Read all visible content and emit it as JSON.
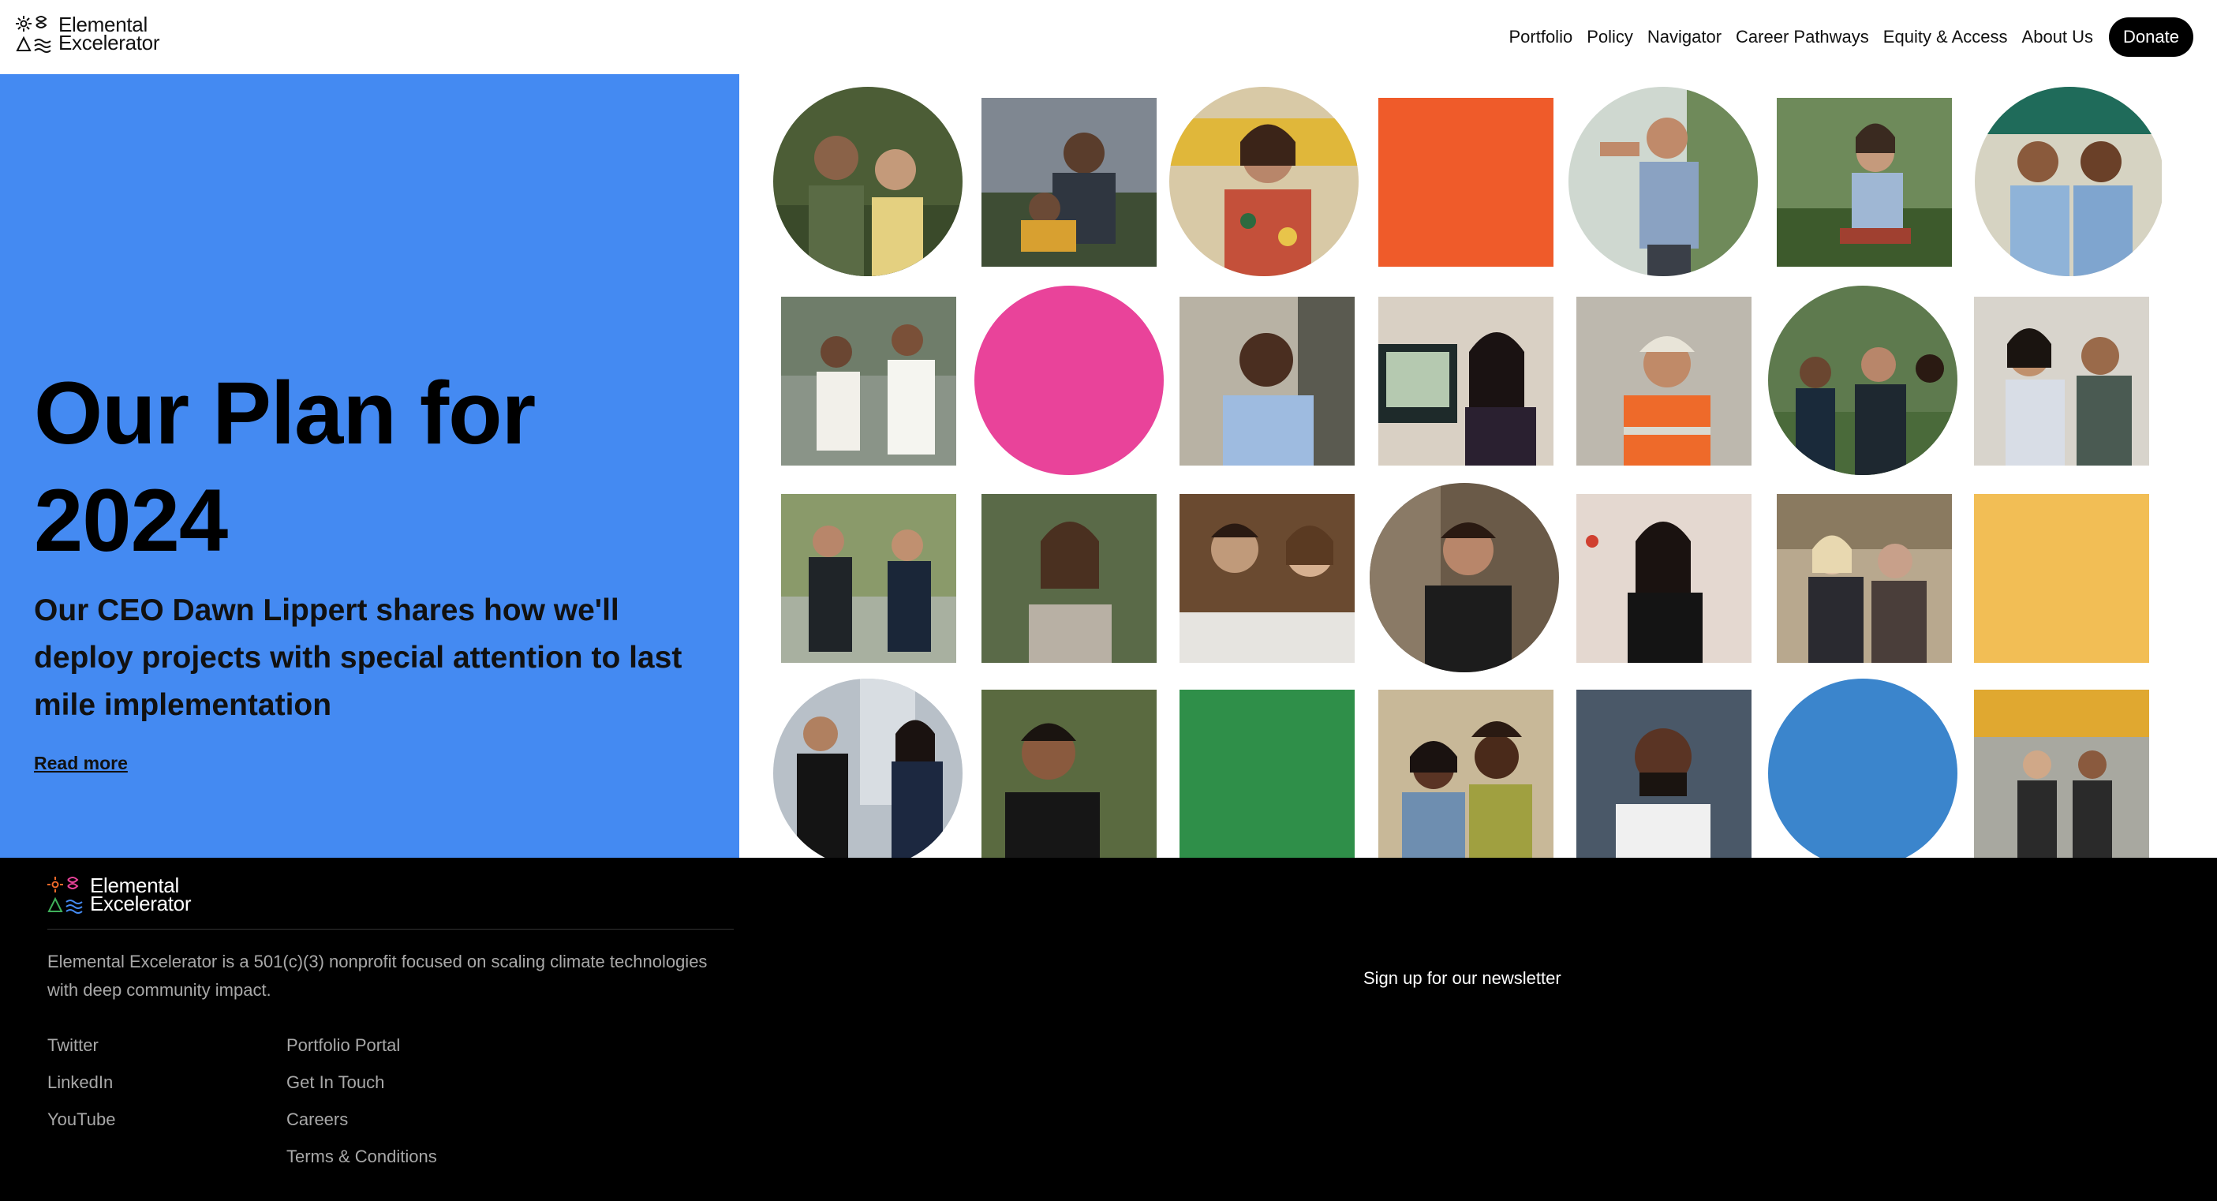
{
  "header": {
    "logo_line1": "Elemental",
    "logo_line2": "Excelerator",
    "nav": [
      "Portfolio",
      "Policy",
      "Navigator",
      "Career Pathways",
      "Equity & Access",
      "About Us"
    ],
    "donate_label": "Donate"
  },
  "hero": {
    "title": "Our Plan for 2024",
    "subtitle": "Our CEO Dawn Lippert shares how we'll deploy projects with special attention to last mile implementation",
    "read_more": "Read more"
  },
  "footer": {
    "logo_line1": "Elemental",
    "logo_line2": "Excelerator",
    "description": "Elemental Excelerator is a 501(c)(3) nonprofit focused on scaling climate technologies with deep community impact.",
    "social": [
      "Twitter",
      "LinkedIn",
      "YouTube"
    ],
    "links": [
      "Portfolio Portal",
      "Get In Touch",
      "Careers",
      "Terms & Conditions"
    ],
    "newsletter": "Sign up for our newsletter"
  },
  "colors": {
    "hero_blue": "#448af2",
    "orange": "#ef5b2a",
    "pink": "#e9439a",
    "yellow": "#f2be55",
    "green": "#2f8f49",
    "blue": "#3b85cc"
  }
}
